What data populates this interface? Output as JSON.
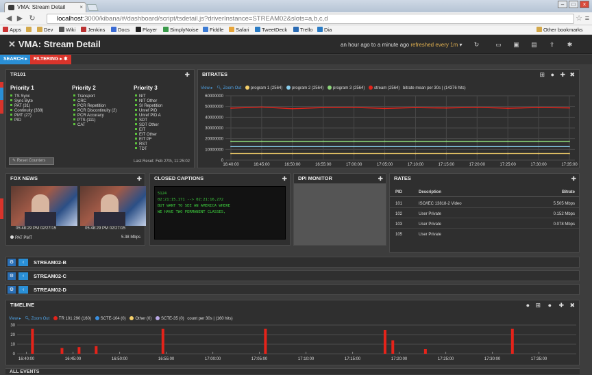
{
  "browser": {
    "tab_title": "VMA: Stream Detail",
    "url_host": "localhost",
    "url_path": ":3000/kibana/#/dashboard/script/tsdetail.js?driverInstance=STREAM02&slots=a,b,c,d",
    "bookmarks": [
      "Apps",
      "Dev",
      "Wiki",
      "Jenkins",
      "Docs",
      "Player",
      "SimplyNoise",
      "Fiddle",
      "Safari",
      "TweetDeck",
      "Trello",
      "Dia"
    ],
    "other_bookmarks": "Other bookmarks"
  },
  "app": {
    "title": "VMA: Stream Detail",
    "time_range": "an hour ago to a minute ago",
    "refreshed": "refreshed every 1m",
    "search_label": "SEARCH",
    "filtering_label": "FILTERING"
  },
  "tr101": {
    "title": "TR101",
    "priority1": {
      "title": "Priority 1",
      "items": [
        "TS Sync",
        "Sync Byte",
        "PAT (31)",
        "Continuity (338)",
        "PMT (27)",
        "PID"
      ]
    },
    "priority2": {
      "title": "Priority 2",
      "items": [
        "Transport",
        "CRC",
        "PCR Repetition",
        "PCR Discontinuity (2)",
        "PCR Accuracy",
        "PTS (111)",
        "CAT"
      ]
    },
    "priority3": {
      "title": "Priority 3",
      "items": [
        "NIT",
        "NIT Other",
        "SI Repetition",
        "Unref PID",
        "Unref PID A",
        "SDT",
        "SDT Other",
        "EIT",
        "EIT Other",
        "EIT PF",
        "RST",
        "TDT"
      ]
    },
    "reset_button": "Reset Counters",
    "last_reset": "Last Reset: Feb 27th, 11:25:02"
  },
  "bitrates": {
    "title": "BITRATES",
    "view": "View",
    "zoom": "Zoom Out",
    "summary": "bitrate mean per 30s | (14376 hits)"
  },
  "chart_data": [
    {
      "type": "line",
      "title": "BITRATES",
      "x": [
        "16:40:00",
        "16:45:00",
        "16:50:00",
        "16:55:00",
        "17:00:00",
        "17:05:00",
        "17:10:00",
        "17:15:00",
        "17:20:00",
        "17:25:00",
        "17:30:00",
        "17:35:00"
      ],
      "ylim": [
        0,
        60000000
      ],
      "yticks": [
        "60000000",
        "50000000",
        "40000000",
        "30000000",
        "20000000",
        "10000000",
        "0"
      ],
      "series": [
        {
          "name": "program 1 (2564)",
          "color": "#f5d06a",
          "values": [
            6100000,
            6100000,
            6100000,
            6100000,
            6100000,
            6100000,
            6100000,
            6100000,
            6100000,
            6100000,
            6100000,
            6100000
          ]
        },
        {
          "name": "program 2 (2564)",
          "color": "#8ad0ef",
          "values": [
            12600000,
            12600000,
            12600000,
            12600000,
            12600000,
            12600000,
            12600000,
            12600000,
            12600000,
            12600000,
            12600000,
            12600000
          ]
        },
        {
          "name": "program 3 (2564)",
          "color": "#8cd67a",
          "values": [
            17500000,
            17500000,
            17500000,
            17500000,
            17500000,
            17500000,
            17500000,
            17500000,
            17500000,
            17500000,
            17500000,
            17500000
          ]
        },
        {
          "name": "stream (2564)",
          "color": "#e5231a",
          "values": [
            48500000,
            49500000,
            48000000,
            49000000,
            49200000,
            48200000,
            49000000,
            48600000,
            49300000,
            48400000,
            49100000,
            48700000
          ]
        }
      ]
    },
    {
      "type": "bar",
      "title": "TIMELINE",
      "x": [
        "16:40:00",
        "16:45:00",
        "16:50:00",
        "16:55:00",
        "17:00:00",
        "17:05:00",
        "17:10:00",
        "17:15:00",
        "17:20:00",
        "17:25:00",
        "17:30:00",
        "17:35:00"
      ],
      "ylim": [
        0,
        30
      ],
      "yticks": [
        "30",
        "20",
        "10",
        "0"
      ],
      "bars": [
        {
          "t": "16:40:30",
          "v": 26
        },
        {
          "t": "16:43:40",
          "v": 6
        },
        {
          "t": "16:45:30",
          "v": 7
        },
        {
          "t": "16:47:20",
          "v": 8
        },
        {
          "t": "16:54:30",
          "v": 26
        },
        {
          "t": "17:05:30",
          "v": 26
        },
        {
          "t": "17:18:20",
          "v": 25
        },
        {
          "t": "17:19:10",
          "v": 14
        },
        {
          "t": "17:22:40",
          "v": 5
        },
        {
          "t": "17:32:00",
          "v": 26
        }
      ],
      "series": [
        {
          "name": "TR 101 290 (160)",
          "color": "#e5231a"
        },
        {
          "name": "SCTE-104 (0)",
          "color": "#3a8fe0"
        },
        {
          "name": "Other (0)",
          "color": "#f5d06a"
        },
        {
          "name": "SCTE-35 (0)",
          "color": "#b9a8e6"
        }
      ]
    }
  ],
  "foxnews": {
    "title": "FOX NEWS",
    "thumb1_time": "05:48:29 PM 02/27/15",
    "thumb2_time": "05:48:29 PM 02/27/15",
    "pmt_label": "PAT PMT",
    "bitrate": "5.38 Mbps"
  },
  "captions": {
    "title": "CLOSED CAPTIONS",
    "lines": [
      "5124",
      "02:21:15,171 --> 02:21:16,272",
      "BUT WANT TO SEE AN AMERICA WHERE",
      "WE HAVE TWO PERMANENT CLASSES,"
    ]
  },
  "dpi": {
    "title": "DPI MONITOR"
  },
  "rates": {
    "title": "RATES",
    "headers": [
      "PID",
      "Description",
      "Bitrate"
    ],
    "rows": [
      [
        "101",
        "ISO/IEC 13818-2 Video",
        "5.505 Mbps"
      ],
      [
        "102",
        "User Private",
        "0.152 Mbps"
      ],
      [
        "103",
        "User Private",
        "0.078 Mbps"
      ],
      [
        "105",
        "User Private",
        ""
      ]
    ]
  },
  "streams": [
    "STREAM02-B",
    "STREAM02-C",
    "STREAM02-D"
  ],
  "timeline": {
    "title": "TIMELINE",
    "view": "View",
    "zoom": "Zoom Out",
    "summary": "count per 30s | (160 hits)"
  },
  "all_events": "ALL EVENTS"
}
